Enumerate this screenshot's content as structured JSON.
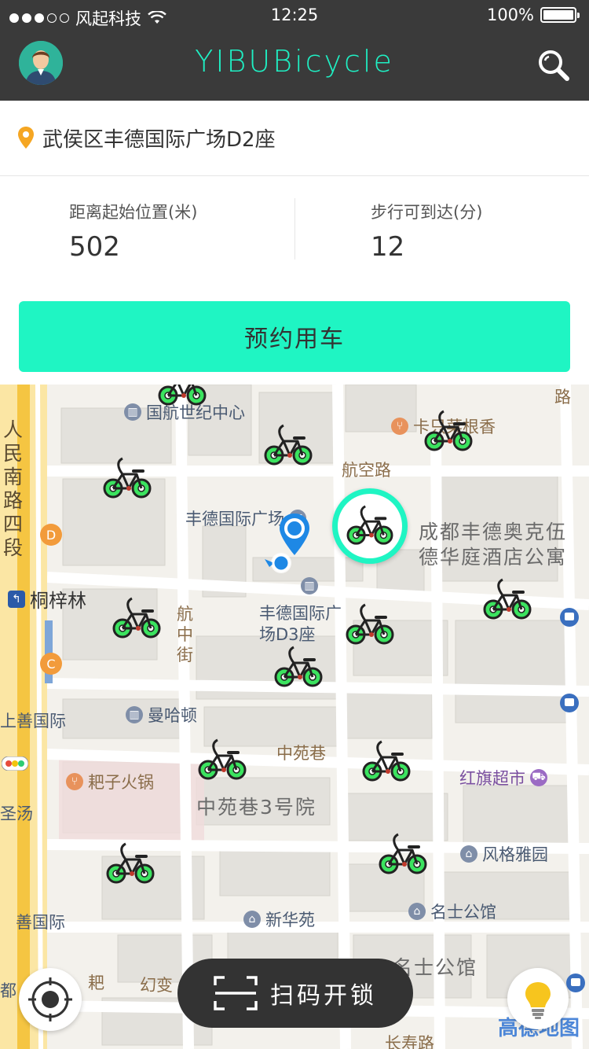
{
  "status_bar": {
    "carrier": "风起科技",
    "time": "12:25",
    "battery": "100%"
  },
  "header": {
    "title": "YIBUBicycle",
    "avatar_icon": "user-avatar-icon",
    "search_icon": "search-icon",
    "accent_color": "#1ff0c4"
  },
  "address": {
    "text": "武侯区丰德国际广场D2座",
    "icon": "location-pin-icon",
    "icon_color": "#f5a623"
  },
  "stats": {
    "distance_label": "距离起始位置(米)",
    "distance_value": "502",
    "walk_label": "步行可到达(分)",
    "walk_value": "12"
  },
  "reserve_button": {
    "label": "预约用车",
    "color": "#1ff5c3"
  },
  "map": {
    "pois": {
      "guohang": "国航世纪中心",
      "xiaomi": "卡只菜根香",
      "fengde_plaza": "丰德国际广场",
      "chengdu_fengde": "成都丰德奥克伍",
      "chengdu_fengde2": "德华庭酒店公寓",
      "fengde_d3_1": "丰德国际广",
      "fengde_d3_2": "场D3座",
      "manhadun": "曼哈顿",
      "hongqi": "红旗超市",
      "yuziguo": "耙子火锅",
      "fengge": "风格雅园",
      "mingshi": "名士公馆",
      "xinhuayuan": "新华苑",
      "tongzilin": "桐梓林",
      "shangshan": "上善国际",
      "shanguoji": "善国际",
      "zhongyuanxiang3": "中苑巷3号院",
      "mingshi_area": "名士公馆",
      "youbian": "幻变",
      "ba": "耙"
    },
    "roads": {
      "hangkong": "航空路",
      "hangzhong_1": "航",
      "hangzhong_2": "中",
      "hangzhong_3": "街",
      "zhongyuan": "中苑巷",
      "renmin_1": "人",
      "renmin_2": "民",
      "renmin_3": "南",
      "renmin_4": "路",
      "renmin_5": "四",
      "renmin_6": "段",
      "lu": "路",
      "changshou": "长寿路",
      "tang": "圣汤",
      "dou": "都",
      "shu": "南"
    },
    "bike_icon": "bicycle-icon",
    "selected_bike_color": "#1ff5c3",
    "watermark": "高德地图"
  },
  "bottom": {
    "scan_label": "扫码开锁",
    "scan_icon": "scan-icon",
    "locate_icon": "locate-icon",
    "light_icon": "lightbulb-icon"
  }
}
